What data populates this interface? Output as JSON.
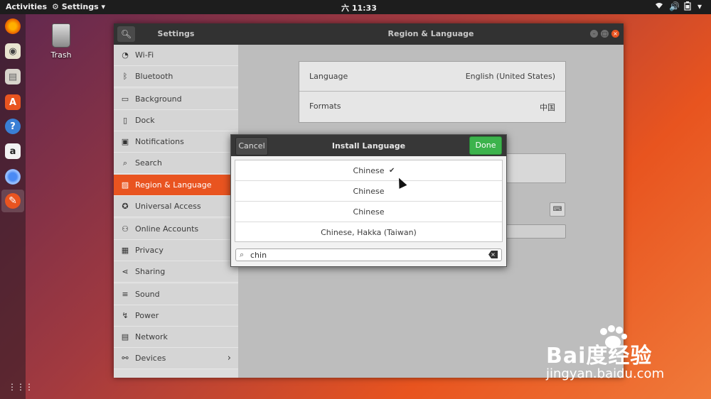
{
  "topbar": {
    "activities": "Activities",
    "app_menu": "Settings",
    "app_menu_arrow": "▾",
    "clock": "六 11:33",
    "icons": [
      "wifi-icon",
      "volume-icon",
      "battery-icon",
      "power-menu-icon"
    ]
  },
  "dock": {
    "items": [
      "firefox-icon",
      "rhythmbox-icon",
      "files-icon",
      "software-icon",
      "help-icon",
      "amazon-icon",
      "chromium-icon",
      "settings-icon"
    ],
    "apps_grid_icon": "show-apps-icon"
  },
  "desktop": {
    "trash_label": "Trash"
  },
  "window": {
    "sidebar_title": "Settings",
    "title": "Region & Language",
    "sidebar": [
      {
        "label": "Wi-Fi",
        "icon": "wifi-icon"
      },
      {
        "label": "Bluetooth",
        "icon": "bluetooth-icon"
      },
      {
        "label": "Background",
        "icon": "background-icon"
      },
      {
        "label": "Dock",
        "icon": "dock-icon"
      },
      {
        "label": "Notifications",
        "icon": "notifications-icon"
      },
      {
        "label": "Search",
        "icon": "search-icon"
      },
      {
        "label": "Region & Language",
        "icon": "region-icon",
        "selected": true
      },
      {
        "label": "Universal Access",
        "icon": "accessibility-icon"
      },
      {
        "label": "Online Accounts",
        "icon": "online-accounts-icon"
      },
      {
        "label": "Privacy",
        "icon": "privacy-icon"
      },
      {
        "label": "Sharing",
        "icon": "sharing-icon"
      },
      {
        "label": "Sound",
        "icon": "sound-icon"
      },
      {
        "label": "Power",
        "icon": "power-icon"
      },
      {
        "label": "Network",
        "icon": "network-icon"
      },
      {
        "label": "Devices",
        "icon": "devices-icon"
      }
    ],
    "main": {
      "language_label": "Language",
      "language_value": "English (United States)",
      "formats_label": "Formats",
      "formats_value": "中国"
    }
  },
  "dialog": {
    "title": "Install Language",
    "cancel": "Cancel",
    "done": "Done",
    "items": [
      {
        "label": "Chinese",
        "checked": true,
        "check": "✔"
      },
      {
        "label": "Chinese"
      },
      {
        "label": "Chinese"
      },
      {
        "label": "Chinese, Hakka (Taiwan)"
      }
    ],
    "search_value": "chin"
  },
  "watermark": {
    "logo": "Bai度经验",
    "url": "jingyan.baidu.com"
  },
  "colors": {
    "accent": "#e95420",
    "done_green": "#3cb34c",
    "topbar": "#1d1d1d"
  }
}
